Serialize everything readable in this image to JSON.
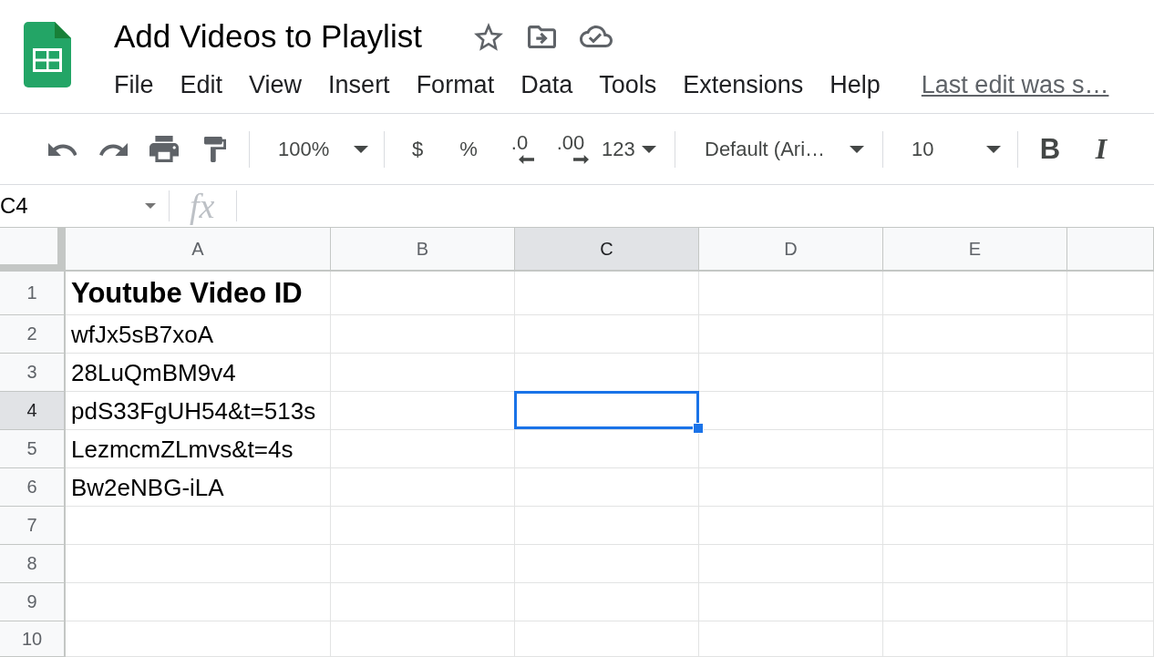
{
  "document": {
    "title": "Add Videos to Playlist"
  },
  "menu_bar": {
    "items": [
      "File",
      "Edit",
      "View",
      "Insert",
      "Format",
      "Data",
      "Tools",
      "Extensions",
      "Help"
    ],
    "last_edit": "Last edit was s…"
  },
  "toolbar": {
    "zoom": "100%",
    "currency": "$",
    "percent": "%",
    "decrease_decimal": ".0",
    "increase_decimal": ".00",
    "more_formats": "123",
    "font": "Default (Ari…",
    "font_size": "10",
    "bold_label": "B",
    "italic_label": "I"
  },
  "formula_bar": {
    "name_box": "C4",
    "function_label": "fx"
  },
  "sheet": {
    "columns": [
      {
        "label": "A",
        "selected": false
      },
      {
        "label": "B",
        "selected": false
      },
      {
        "label": "C",
        "selected": true
      },
      {
        "label": "D",
        "selected": false
      },
      {
        "label": "E",
        "selected": false
      }
    ],
    "rows": [
      {
        "number": "1",
        "selected": false,
        "cells": [
          {
            "text": "Youtube Video ID",
            "bold": true
          }
        ]
      },
      {
        "number": "2",
        "selected": false,
        "cells": [
          {
            "text": "wfJx5sB7xoA",
            "bold": false
          }
        ]
      },
      {
        "number": "3",
        "selected": false,
        "cells": [
          {
            "text": "28LuQmBM9v4",
            "bold": false
          }
        ]
      },
      {
        "number": "4",
        "selected": true,
        "cells": [
          {
            "text": "pdS33FgUH54&t=513s",
            "bold": false
          }
        ]
      },
      {
        "number": "5",
        "selected": false,
        "cells": [
          {
            "text": "LezmcmZLmvs&t=4s",
            "bold": false
          }
        ]
      },
      {
        "number": "6",
        "selected": false,
        "cells": [
          {
            "text": "Bw2eNBG-iLA",
            "bold": false
          }
        ]
      },
      {
        "number": "7",
        "selected": false
      },
      {
        "number": "8",
        "selected": false
      },
      {
        "number": "9",
        "selected": false
      },
      {
        "number": "10",
        "selected": false
      }
    ]
  }
}
